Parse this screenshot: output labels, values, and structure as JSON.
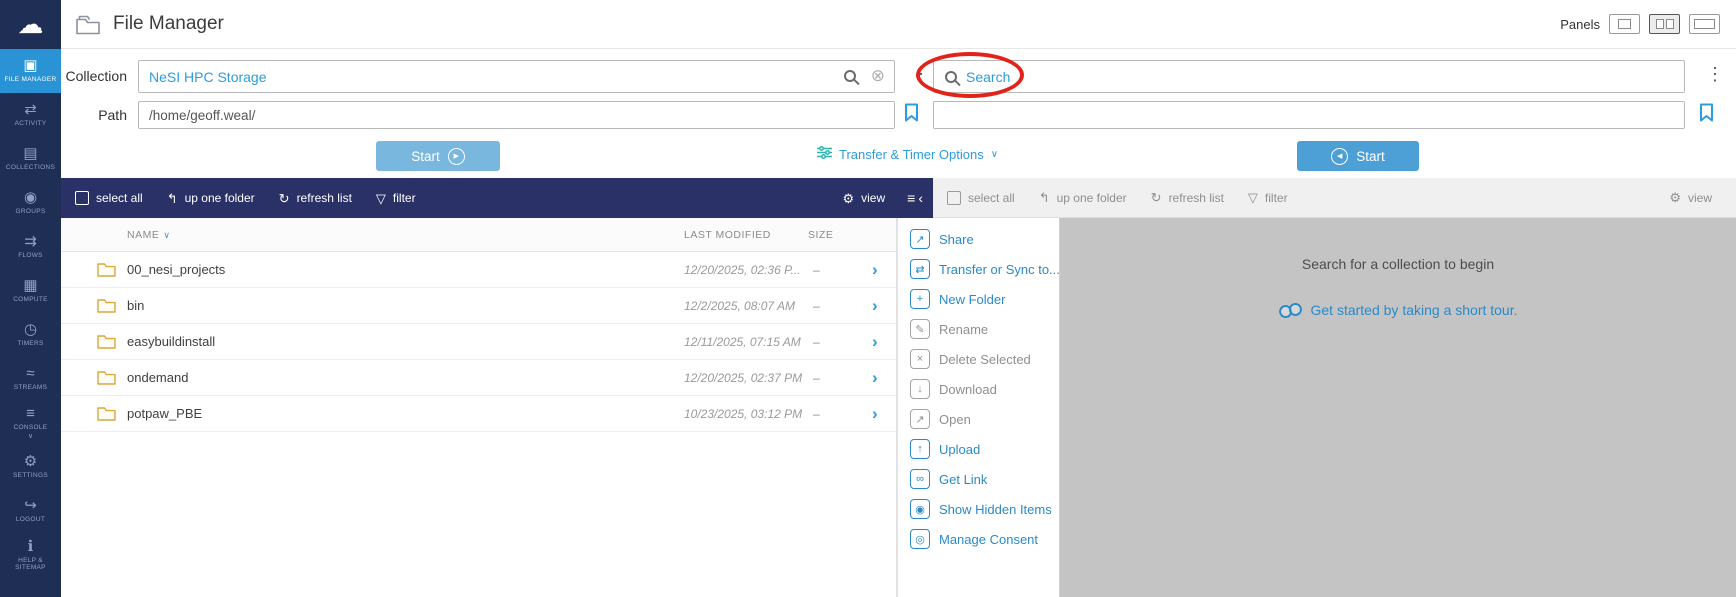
{
  "colors": {
    "accent": "#2d9cdb",
    "sidebar": "#1f2e55",
    "sidebar_active": "#2a93d5",
    "toolbar_dark": "#2a3166",
    "annotation_red": "#e2231a",
    "empty_panel": "#c4c4c4",
    "folder_amber": "#dca63a"
  },
  "header": {
    "title": "File Manager",
    "panels_label": "Panels"
  },
  "sidebar": {
    "items": [
      {
        "label": "FILE MANAGER",
        "icon": "file-manager-icon",
        "active": true
      },
      {
        "label": "ACTIVITY",
        "icon": "activity-icon"
      },
      {
        "label": "COLLECTIONS",
        "icon": "collections-icon"
      },
      {
        "label": "GROUPS",
        "icon": "groups-icon"
      },
      {
        "label": "FLOWS",
        "icon": "flows-icon"
      },
      {
        "label": "COMPUTE",
        "icon": "compute-icon"
      },
      {
        "label": "TIMERS",
        "icon": "timers-icon"
      },
      {
        "label": "STREAMS",
        "icon": "streams-icon"
      },
      {
        "label": "CONSOLE",
        "icon": "console-icon",
        "chevron": true
      },
      {
        "label": "SETTINGS",
        "icon": "settings-icon"
      },
      {
        "label": "LOGOUT",
        "icon": "logout-icon"
      },
      {
        "label": "HELP & SITEMAP",
        "icon": "help-icon"
      }
    ]
  },
  "left_panel": {
    "collection_label": "Collection",
    "collection_value": "NeSI HPC Storage",
    "path_label": "Path",
    "path_value": "/home/geoff.weal/",
    "start_label": "Start"
  },
  "transfer_options": {
    "label": "Transfer & Timer Options"
  },
  "right_panel": {
    "search_placeholder": "Search",
    "start_label": "Start",
    "empty_message": "Search for a collection to begin",
    "tour_link": "Get started by taking a short tour."
  },
  "toolbar": {
    "select_all": "select all",
    "up_one_folder": "up one folder",
    "refresh_list": "refresh list",
    "filter": "filter",
    "view": "view"
  },
  "table": {
    "headers": {
      "name": "NAME",
      "modified": "LAST MODIFIED",
      "size": "SIZE"
    },
    "rows": [
      {
        "name": "00_nesi_projects",
        "modified": "12/20/2025, 02:36 P...",
        "size": "–"
      },
      {
        "name": "bin",
        "modified": "12/2/2025, 08:07 AM",
        "size": "–"
      },
      {
        "name": "easybuildinstall",
        "modified": "12/11/2025, 07:15 AM",
        "size": "–"
      },
      {
        "name": "ondemand",
        "modified": "12/20/2025, 02:37 PM",
        "size": "–"
      },
      {
        "name": "potpaw_PBE",
        "modified": "10/23/2025, 03:12 PM",
        "size": "–"
      }
    ]
  },
  "action_menu": {
    "items": [
      {
        "label": "Share",
        "icon": "share-icon",
        "enabled": true
      },
      {
        "label": "Transfer or Sync to...",
        "icon": "transfer-icon",
        "enabled": true
      },
      {
        "label": "New Folder",
        "icon": "new-folder-icon",
        "enabled": true
      },
      {
        "label": "Rename",
        "icon": "rename-icon",
        "enabled": false
      },
      {
        "label": "Delete Selected",
        "icon": "delete-icon",
        "enabled": false
      },
      {
        "label": "Download",
        "icon": "download-icon",
        "enabled": false
      },
      {
        "label": "Open",
        "icon": "open-icon",
        "enabled": false
      },
      {
        "label": "Upload",
        "icon": "upload-icon",
        "enabled": true
      },
      {
        "label": "Get Link",
        "icon": "get-link-icon",
        "enabled": true
      },
      {
        "label": "Show Hidden Items",
        "icon": "show-hidden-icon",
        "enabled": true
      },
      {
        "label": "Manage Consent",
        "icon": "consent-icon",
        "enabled": true
      }
    ]
  },
  "glyphs": {
    "cloud-icon": "☁",
    "file-manager-icon": "▣",
    "activity-icon": "⇄",
    "collections-icon": "▤",
    "groups-icon": "◉",
    "flows-icon": "⇉",
    "compute-icon": "▦",
    "timers-icon": "◷",
    "streams-icon": "≈",
    "console-icon": "≡",
    "settings-icon": "⚙",
    "logout-icon": "↪",
    "help-icon": "ℹ",
    "share-icon": "↗",
    "transfer-icon": "⇄",
    "new-folder-icon": "+",
    "rename-icon": "✎",
    "delete-icon": "×",
    "download-icon": "↓",
    "open-icon": "↗",
    "upload-icon": "↑",
    "get-link-icon": "∞",
    "show-hidden-icon": "◉",
    "consent-icon": "◎",
    "chevron-down-icon": "∨",
    "chevron-right-icon": "›",
    "chevron-left-icon": "‹",
    "dots-vertical-icon": "⋮",
    "clear-icon": "⊗",
    "up-one-folder-icon": "↰",
    "refresh-icon": "↻",
    "filter-icon": "▽",
    "gear-icon": "⚙",
    "menu-icon": "≡",
    "play-icon": "▶",
    "arrow-left-circle-icon": "◀"
  }
}
